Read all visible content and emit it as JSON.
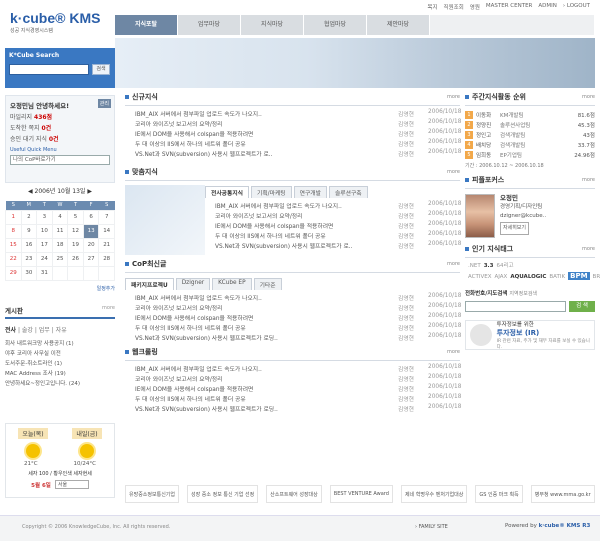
{
  "top_links": [
    "목지",
    "직원조회",
    "영원",
    "MASTER CENTER",
    "ADMIN",
    "› LOGOUT"
  ],
  "logo": {
    "brand": "k·cube® KMS",
    "sub": "성공 지식경영시스템"
  },
  "nav": [
    "지식포탈",
    "업무마당",
    "지식마당",
    "협업마당",
    "제안마당"
  ],
  "search": {
    "title": "K*Cube Search",
    "button": "검색"
  },
  "login": {
    "greeting": "오정민님 안녕하세요!",
    "edit_btn": "관리",
    "line1_label": "마일리지",
    "line1_value": "436점",
    "line2_label": "도착한 쪽지",
    "line2_value": "0건",
    "line3_label": "승인 대기 지식",
    "line3_value": "0건",
    "menu_label": "Useful Quick Menu",
    "select": "나의 CoP바로가기"
  },
  "calendar": {
    "title": "◀ 2006년 10월 13일 ▶",
    "days": [
      "S",
      "M",
      "T",
      "W",
      "T",
      "F",
      "S"
    ],
    "weeks": [
      [
        "1",
        "2",
        "3",
        "4",
        "5",
        "6",
        "7"
      ],
      [
        "8",
        "9",
        "10",
        "11",
        "12",
        "13",
        "14"
      ],
      [
        "15",
        "16",
        "17",
        "18",
        "19",
        "20",
        "21"
      ],
      [
        "22",
        "23",
        "24",
        "25",
        "26",
        "27",
        "28"
      ],
      [
        "29",
        "30",
        "31",
        "",
        "",
        "",
        ""
      ]
    ],
    "more": "일정추가"
  },
  "board": {
    "title": "게시판",
    "more": "more",
    "tabs": [
      "전사",
      "술강",
      "업무",
      "자유"
    ],
    "items": [
      "회사 내트워크망 사용공지 (1)",
      "야후 코리아 사무실 이전",
      "도서주문-취소트라인 (1)",
      "MAC Address 조사 (19)",
      "안녕하세요~정인고입니다. (24)"
    ]
  },
  "weather": {
    "today": "오늘(목)",
    "tomorrow": "내일(금)",
    "t1": "21°C",
    "t2": "10/24°C",
    "note": "세자 100 / 황우인색 세자현세",
    "month": "5월 6일",
    "select": "서울"
  },
  "new_knowledge": {
    "title": "신규지식",
    "more": "more",
    "items": [
      {
        "t": "IBM_AIX 서버에서 첨부파일 업로드 속도가 나오지..",
        "a": "김영현",
        "d": "2006/10/18"
      },
      {
        "t": "코리아 와이즈넛 보고서의 요약/정리",
        "a": "김영현",
        "d": "2006/10/18"
      },
      {
        "t": "IE에서 DOM을 사용해서 colspan을 적용하려면",
        "a": "김영현",
        "d": "2006/10/18"
      },
      {
        "t": "두 대 이상의 IIS에서 하나의 네트워 폴더 공유",
        "a": "김영현",
        "d": "2006/10/18"
      },
      {
        "t": "VS.Net과 SVN(subversion) 사용시 웹프로젝트가 로..",
        "a": "김영현",
        "d": "2006/10/18"
      }
    ]
  },
  "custom_knowledge": {
    "title": "맞춤지식",
    "more": "more",
    "tabs": [
      "전사공통지식",
      "기획/마케팅",
      "연구개발",
      "솔루션구축"
    ],
    "items": [
      {
        "t": "IBM_AIX 서버에서 첨부파일 업로드 속도가 나오지..",
        "a": "김영현",
        "d": "2006/10/18"
      },
      {
        "t": "코리아 와이즈넛 보고서의 요약/정리",
        "a": "김영현",
        "d": "2006/10/18"
      },
      {
        "t": "IE에서 DOM을 사용해서 colspan을 적용하려면",
        "a": "김영현",
        "d": "2006/10/18"
      },
      {
        "t": "두 대 이상의 IIS에서 하나의 네트워 폴더 공유",
        "a": "김영현",
        "d": "2006/10/18"
      },
      {
        "t": "VS.Net과 SVN(subversion) 사용시 웹프로젝트가 로..",
        "a": "김영현",
        "d": "2006/10/18"
      }
    ]
  },
  "cop": {
    "title": "CoP최신글",
    "more": "more",
    "tabs": [
      "패키지프로젝U",
      "Dzigner",
      "KCube EP",
      "기타준"
    ],
    "items": [
      {
        "t": "IBM_AIX 서버에서 첨부파일 업로드 속도가 나오지..",
        "a": "김영현",
        "d": "2006/10/18"
      },
      {
        "t": "코리아 와이즈넛 보고서의 요약/정리",
        "a": "김영현",
        "d": "2006/10/18"
      },
      {
        "t": "IE에서 DOM을 사용해서 colspan을 적용하려면",
        "a": "김영현",
        "d": "2006/10/18"
      },
      {
        "t": "두 대 이상의 IIS에서 하나의 네트워 폴더 공유",
        "a": "김영현",
        "d": "2006/10/18"
      },
      {
        "t": "VS.Net과 SVN(subversion) 사용시 웹프로젝트가 로딩..",
        "a": "김영현",
        "d": "2006/10/18"
      }
    ]
  },
  "web_clip": {
    "title": "웹크롤링",
    "more": "more",
    "items": [
      {
        "t": "IBM_AIX 서버에서 첨부파일 업로드 속도가 나오지..",
        "a": "김영현",
        "d": "2006/10/18"
      },
      {
        "t": "코리아 와이즈넛 보고서의 요약/정리",
        "a": "김영현",
        "d": "2006/10/18"
      },
      {
        "t": "IE에서 DOM을 사용해서 colspan을 적용하려면",
        "a": "김영현",
        "d": "2006/10/18"
      },
      {
        "t": "두 대 이상의 IIS에서 하나의 네트워 폴더 공유",
        "a": "김영현",
        "d": "2006/10/18"
      },
      {
        "t": "VS.Net과 SVN(subversion) 사용시 웹프로젝트가 로딩..",
        "a": "김영현",
        "d": "2006/10/18"
      }
    ]
  },
  "weekly_rank": {
    "title": "주간지식활동 순위",
    "more": "more",
    "items": [
      {
        "n": "1",
        "name": "이동화",
        "dept": "KM개발팀",
        "score": "81.6점"
      },
      {
        "n": "2",
        "name": "정양진",
        "dept": "솔루션사업팀",
        "score": "45.3점"
      },
      {
        "n": "3",
        "name": "정인고",
        "dept": "검색개발팀",
        "score": "43점"
      },
      {
        "n": "4",
        "name": "배치당",
        "dept": "검색개발팀",
        "score": "33.7점"
      },
      {
        "n": "5",
        "name": "임희동",
        "dept": "EP기업팀",
        "score": "24.96점"
      }
    ],
    "period": "기간 : 2006.10.12 ~ 2006.10.18"
  },
  "people": {
    "title": "피플포커스",
    "more": "more",
    "name": "오정민",
    "dept": "경영기획/디자인팀",
    "email": "dzigner@kcube..",
    "btn": "자세히보기"
  },
  "tags": {
    "title": "인기 지식태그",
    "more": "more",
    "words": [
      ".NET",
      "3.3",
      "64리고",
      "ACTIVEX",
      "AJAX",
      "AQUALOGIC",
      "BATIK",
      "BPM",
      "BRUNEI",
      "BSC",
      "CMS",
      "IE",
      "ISV",
      "JEUS",
      "KMS",
      "KOD",
      "LIG",
      "BEA",
      "EP",
      "BSC",
      "CMS",
      "AJAX",
      "AQUALOGIC",
      "BATIK",
      "BPM",
      "BRUNEI"
    ]
  },
  "phone": {
    "label": "전화번호/지도검색",
    "sub": "지역정보검색",
    "btn": "검 색"
  },
  "ir": {
    "small": "투자정보를 위한",
    "title": "투자정보 (IR)",
    "desc": "IR 관련 자료, 주가 및 재무 자료를 보실 수 있습니다."
  },
  "banners": [
    "유망중소정보통신기업",
    "성장 중소 정보 통신 기업 선정",
    "산소프트웨어 성장대상",
    "BEST VENTURE Award",
    "제네 혁명우수 벤처기업대상",
    "GS 인증 마크 획득",
    "병무청 www.mma.go.kr"
  ],
  "footer": {
    "copyright": "Copyright © 2006 KnowledgeCube, Inc. All rights reserved.",
    "family": "› FAMILY SITE",
    "powered": "Powered by",
    "brand": "k·cube® KMS R3"
  }
}
